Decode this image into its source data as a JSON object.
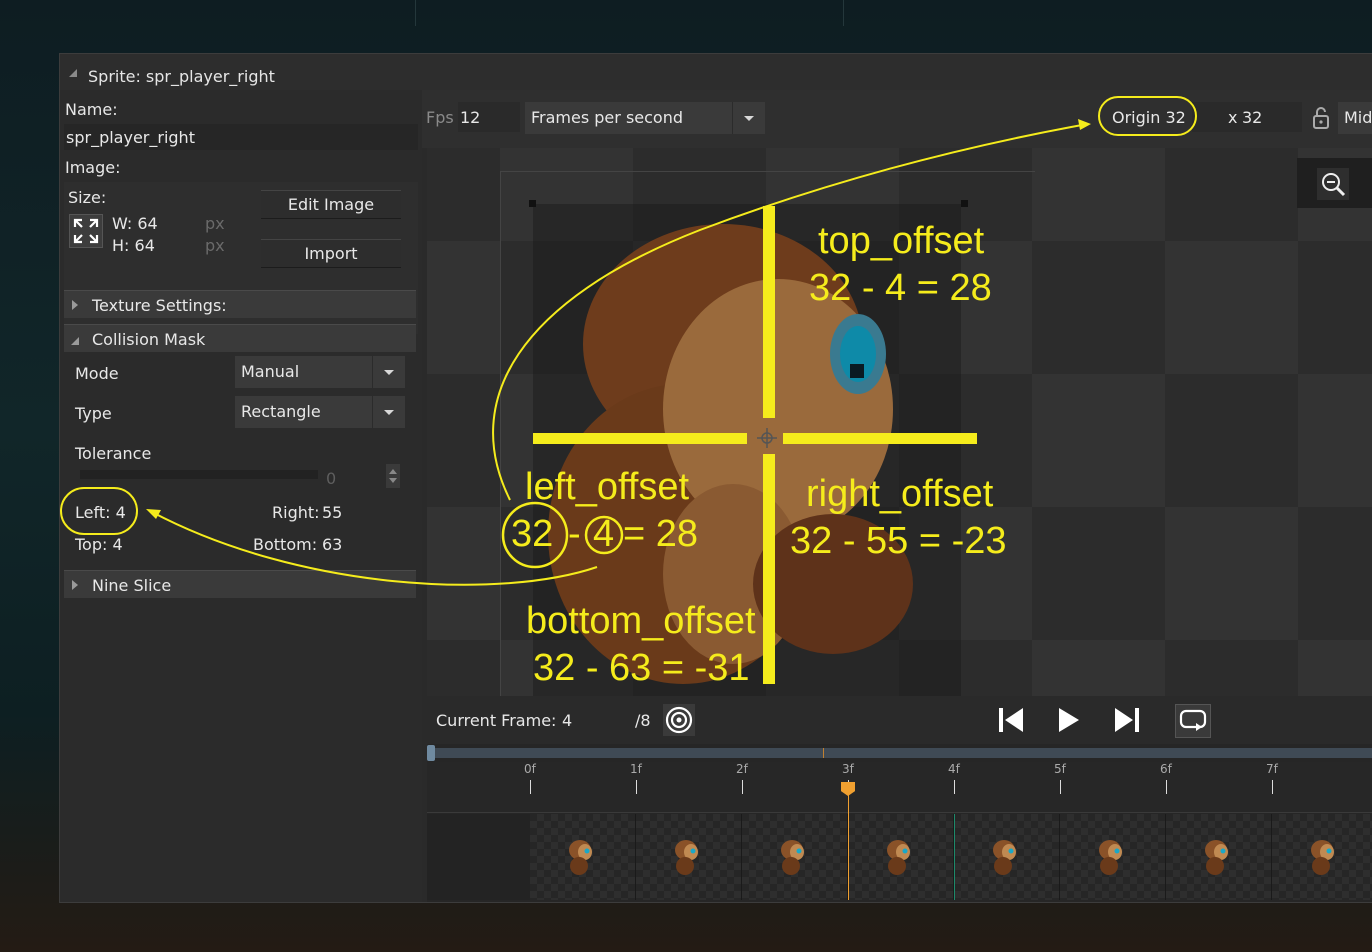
{
  "window": {
    "title": "Sprite: spr_player_right"
  },
  "left_panel": {
    "name_label": "Name:",
    "name_value": "spr_player_right",
    "image_label": "Image:",
    "size_label": "Size:",
    "width": "W: 64",
    "height": "H: 64",
    "unit_w": "px",
    "unit_h": "px",
    "edit_image": "Edit Image",
    "import": "Import",
    "texture_settings": "Texture Settings:",
    "collision_mask": "Collision Mask",
    "mode_label": "Mode",
    "mode_value": "Manual",
    "type_label": "Type",
    "type_value": "Rectangle",
    "tolerance_label": "Tolerance",
    "tolerance_value": "0",
    "left": "Left: 4",
    "right_label": "Right:",
    "right_value": "55",
    "top": "Top: 4",
    "bottom_label": "Bottom:",
    "bottom_value": "63",
    "nine_slice": "Nine Slice"
  },
  "toolbar": {
    "fps_label": "Fps",
    "fps_value": "12",
    "fps_mode": "Frames per second",
    "origin_label": "Origin 32",
    "origin_y_label": "x",
    "origin_y_value": "32",
    "origin_preset": "Mid"
  },
  "annotations": {
    "top_title": "top_offset",
    "top_eq": "32 - 4 = 28",
    "left_title": "left_offset",
    "left_a": "32",
    "left_b": "4",
    "left_dash": "-",
    "left_eq": "= 28",
    "right_title": "right_offset",
    "right_eq": "32 - 55 = -23",
    "bottom_title": "bottom_offset",
    "bottom_eq": "32 - 63 = -31",
    "color": "#f5ec1c"
  },
  "playback": {
    "current_frame_label": "Current Frame:",
    "current_frame_value": "4",
    "total_frames": "/8"
  },
  "timeline": {
    "ticks": [
      "0f",
      "1f",
      "2f",
      "3f",
      "4f",
      "5f",
      "6f",
      "7f"
    ],
    "playhead_color": "#f0a030"
  },
  "colors": {
    "accent_yellow": "#f5ec1c",
    "playhead": "#f0a030",
    "panel_bg": "#2b2b2b"
  }
}
